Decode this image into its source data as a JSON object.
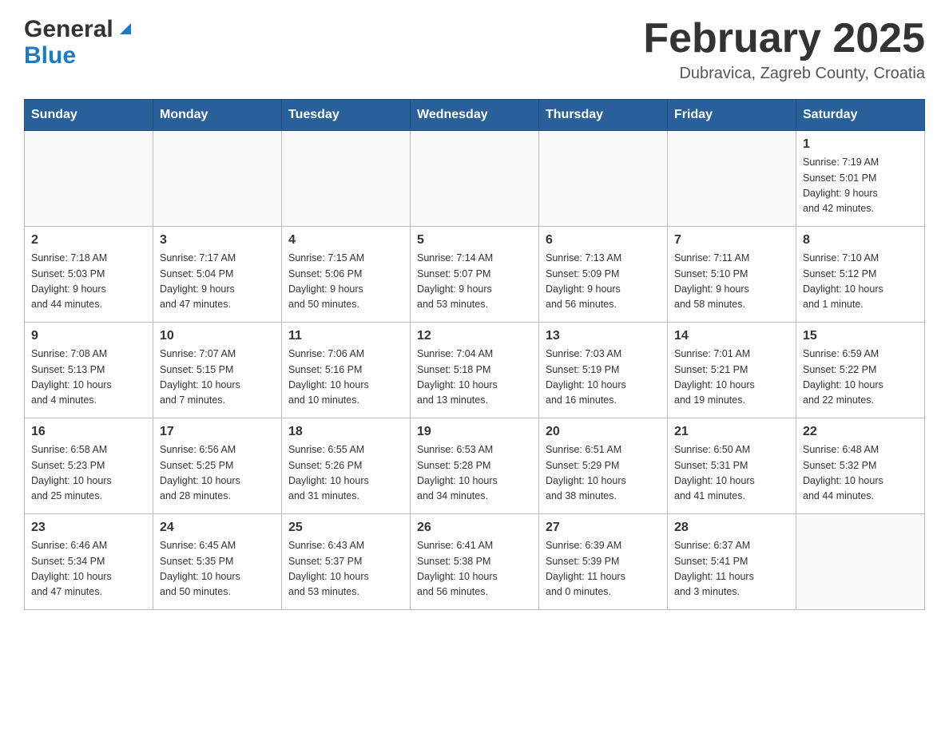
{
  "header": {
    "logo": {
      "general": "General",
      "blue": "Blue",
      "triangle_aria": "logo triangle"
    },
    "title": "February 2025",
    "location": "Dubravica, Zagreb County, Croatia"
  },
  "weekdays": [
    "Sunday",
    "Monday",
    "Tuesday",
    "Wednesday",
    "Thursday",
    "Friday",
    "Saturday"
  ],
  "weeks": [
    [
      {
        "day": "",
        "info": ""
      },
      {
        "day": "",
        "info": ""
      },
      {
        "day": "",
        "info": ""
      },
      {
        "day": "",
        "info": ""
      },
      {
        "day": "",
        "info": ""
      },
      {
        "day": "",
        "info": ""
      },
      {
        "day": "1",
        "info": "Sunrise: 7:19 AM\nSunset: 5:01 PM\nDaylight: 9 hours\nand 42 minutes."
      }
    ],
    [
      {
        "day": "2",
        "info": "Sunrise: 7:18 AM\nSunset: 5:03 PM\nDaylight: 9 hours\nand 44 minutes."
      },
      {
        "day": "3",
        "info": "Sunrise: 7:17 AM\nSunset: 5:04 PM\nDaylight: 9 hours\nand 47 minutes."
      },
      {
        "day": "4",
        "info": "Sunrise: 7:15 AM\nSunset: 5:06 PM\nDaylight: 9 hours\nand 50 minutes."
      },
      {
        "day": "5",
        "info": "Sunrise: 7:14 AM\nSunset: 5:07 PM\nDaylight: 9 hours\nand 53 minutes."
      },
      {
        "day": "6",
        "info": "Sunrise: 7:13 AM\nSunset: 5:09 PM\nDaylight: 9 hours\nand 56 minutes."
      },
      {
        "day": "7",
        "info": "Sunrise: 7:11 AM\nSunset: 5:10 PM\nDaylight: 9 hours\nand 58 minutes."
      },
      {
        "day": "8",
        "info": "Sunrise: 7:10 AM\nSunset: 5:12 PM\nDaylight: 10 hours\nand 1 minute."
      }
    ],
    [
      {
        "day": "9",
        "info": "Sunrise: 7:08 AM\nSunset: 5:13 PM\nDaylight: 10 hours\nand 4 minutes."
      },
      {
        "day": "10",
        "info": "Sunrise: 7:07 AM\nSunset: 5:15 PM\nDaylight: 10 hours\nand 7 minutes."
      },
      {
        "day": "11",
        "info": "Sunrise: 7:06 AM\nSunset: 5:16 PM\nDaylight: 10 hours\nand 10 minutes."
      },
      {
        "day": "12",
        "info": "Sunrise: 7:04 AM\nSunset: 5:18 PM\nDaylight: 10 hours\nand 13 minutes."
      },
      {
        "day": "13",
        "info": "Sunrise: 7:03 AM\nSunset: 5:19 PM\nDaylight: 10 hours\nand 16 minutes."
      },
      {
        "day": "14",
        "info": "Sunrise: 7:01 AM\nSunset: 5:21 PM\nDaylight: 10 hours\nand 19 minutes."
      },
      {
        "day": "15",
        "info": "Sunrise: 6:59 AM\nSunset: 5:22 PM\nDaylight: 10 hours\nand 22 minutes."
      }
    ],
    [
      {
        "day": "16",
        "info": "Sunrise: 6:58 AM\nSunset: 5:23 PM\nDaylight: 10 hours\nand 25 minutes."
      },
      {
        "day": "17",
        "info": "Sunrise: 6:56 AM\nSunset: 5:25 PM\nDaylight: 10 hours\nand 28 minutes."
      },
      {
        "day": "18",
        "info": "Sunrise: 6:55 AM\nSunset: 5:26 PM\nDaylight: 10 hours\nand 31 minutes."
      },
      {
        "day": "19",
        "info": "Sunrise: 6:53 AM\nSunset: 5:28 PM\nDaylight: 10 hours\nand 34 minutes."
      },
      {
        "day": "20",
        "info": "Sunrise: 6:51 AM\nSunset: 5:29 PM\nDaylight: 10 hours\nand 38 minutes."
      },
      {
        "day": "21",
        "info": "Sunrise: 6:50 AM\nSunset: 5:31 PM\nDaylight: 10 hours\nand 41 minutes."
      },
      {
        "day": "22",
        "info": "Sunrise: 6:48 AM\nSunset: 5:32 PM\nDaylight: 10 hours\nand 44 minutes."
      }
    ],
    [
      {
        "day": "23",
        "info": "Sunrise: 6:46 AM\nSunset: 5:34 PM\nDaylight: 10 hours\nand 47 minutes."
      },
      {
        "day": "24",
        "info": "Sunrise: 6:45 AM\nSunset: 5:35 PM\nDaylight: 10 hours\nand 50 minutes."
      },
      {
        "day": "25",
        "info": "Sunrise: 6:43 AM\nSunset: 5:37 PM\nDaylight: 10 hours\nand 53 minutes."
      },
      {
        "day": "26",
        "info": "Sunrise: 6:41 AM\nSunset: 5:38 PM\nDaylight: 10 hours\nand 56 minutes."
      },
      {
        "day": "27",
        "info": "Sunrise: 6:39 AM\nSunset: 5:39 PM\nDaylight: 11 hours\nand 0 minutes."
      },
      {
        "day": "28",
        "info": "Sunrise: 6:37 AM\nSunset: 5:41 PM\nDaylight: 11 hours\nand 3 minutes."
      },
      {
        "day": "",
        "info": ""
      }
    ]
  ]
}
